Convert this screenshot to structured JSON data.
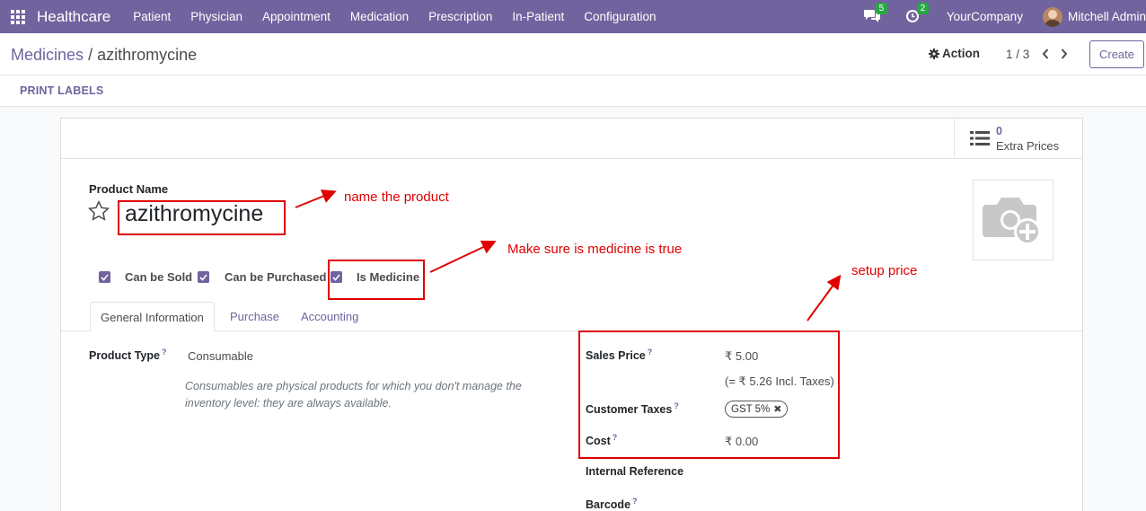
{
  "navbar": {
    "brand": "Healthcare",
    "menu": [
      "Patient",
      "Physician",
      "Appointment",
      "Medication",
      "Prescription",
      "In-Patient",
      "Configuration"
    ],
    "messages_badge": "5",
    "activities_badge": "2",
    "company": "YourCompany",
    "user": "Mitchell Admin",
    "icons": {
      "apps": "apps-grid-icon",
      "messages": "chat-bubbles-icon",
      "activities": "clock-icon"
    }
  },
  "control": {
    "breadcrumb_root": "Medicines",
    "breadcrumb_sep": "/",
    "breadcrumb_current": "azithromycine",
    "action_label": "Action",
    "pager": "1 / 3",
    "create_label": "Create"
  },
  "statusbar": {
    "print_labels": "PRINT LABELS"
  },
  "form": {
    "smart_button": {
      "count": "0",
      "label": "Extra Prices"
    },
    "product_name_label": "Product Name",
    "product_name": "azithromycine",
    "checkboxes": [
      {
        "label": "Can be Sold",
        "checked": true
      },
      {
        "label": "Can be Purchased",
        "checked": true
      },
      {
        "label": "Is Medicine",
        "checked": true
      }
    ],
    "tabs": [
      "General Information",
      "Purchase",
      "Accounting"
    ],
    "active_tab": "General Information",
    "product_type_label": "Product Type",
    "product_type": "Consumable",
    "product_type_help": "Consumables are physical products for which you don't manage the inventory level: they are always available.",
    "sales_price_label": "Sales Price",
    "sales_price": "₹ 5.00",
    "incl_taxes": "(= ₹ 5.26 Incl. Taxes)",
    "customer_taxes_label": "Customer Taxes",
    "customer_tax_tag": "GST 5%",
    "cost_label": "Cost",
    "cost": "₹ 0.00",
    "internal_reference_label": "Internal Reference",
    "barcode_label": "Barcode",
    "help_mark": "?"
  },
  "annotations": {
    "name_note": "name the product",
    "medicine_note": "Make sure is medicine is true",
    "price_note": "setup price",
    "color": "#e00000"
  },
  "colors": {
    "primary": "#71639e",
    "badge": "#28a745"
  }
}
